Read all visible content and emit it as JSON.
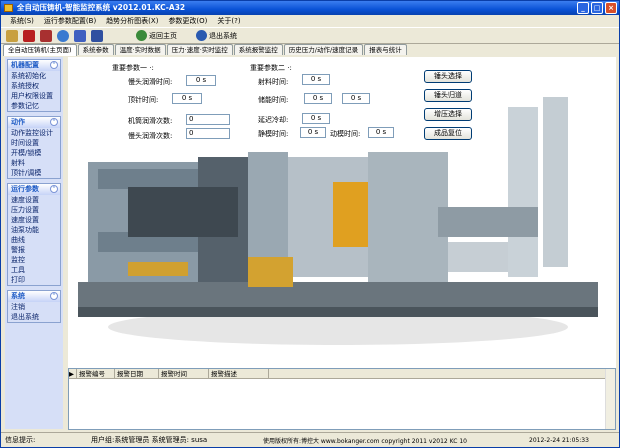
{
  "window": {
    "title": "全自动压铸机-智能监控系统 v2012.01.KC-A32"
  },
  "menu": [
    "系统(S)",
    "运行参数配置(B)",
    "趋势分析图表(X)",
    "参数更改(O)",
    "关于(?)"
  ],
  "toolbar": {
    "home_label": "返回主页",
    "exit_label": "退出系统"
  },
  "tabs": [
    "全自动压铸机(主页面)",
    "系统参数",
    "温度·实时数据",
    "压力·速度·实时监控",
    "系统报警监控",
    "历史压力/动作/速度记录",
    "报表与统计"
  ],
  "sidebar": [
    {
      "title": "机器配置",
      "items": [
        "系统初始化",
        "系统授权",
        "用户权限设置",
        "参数记忆"
      ]
    },
    {
      "title": "动作",
      "items": [
        "动作监控设计",
        "时间设置",
        "开模/锁模",
        "射料",
        "顶针/调模"
      ]
    },
    {
      "title": "运行参数",
      "items": [
        "速度设置",
        "压力设置",
        "速度设置",
        "油泵功能",
        "曲线",
        "警报",
        "监控",
        "工具",
        "打印"
      ]
    },
    {
      "title": "系统",
      "items": [
        "注销",
        "退出系统"
      ]
    }
  ],
  "params": {
    "group1_title": "重要参数一 ·:",
    "group2_title": "重要参数二 ·:",
    "f1_label": "慢头润滑时间:",
    "f1_value": "0 s",
    "f2_label": "顶针时间:",
    "f2_value": "0 s",
    "f3_label": "机筒润滑次数:",
    "f3_value": "0",
    "f4_label": "慢头润滑次数:",
    "f4_value": "0",
    "f5_label": "射料时间:",
    "f5_value": "0 s",
    "f6_label": "储能时间:",
    "f6_value": "0 s",
    "f6b_value": "0 s",
    "f7_label": "延迟冷却:",
    "f7_value": "0 s",
    "f8_label": "静模时间:",
    "f8_value": "0 s",
    "f9_label": "动模时间:",
    "f9_value": "0 s"
  },
  "actions": [
    "锤头选择",
    "锤头归道",
    "增压选择",
    "成品复位"
  ],
  "alarm_table": {
    "columns": [
      "报警编号",
      "报警日期",
      "报警时间",
      "报警描述"
    ]
  },
  "status": {
    "hint_label": "信息提示:",
    "user": "用户组:系统管理员  系统管理员: susa",
    "copyright": "使用版权所有:博控大 www.bokanger.com copyright 2011 v2012 KC 10",
    "datetime": "2012-2-24 21:05:33"
  }
}
